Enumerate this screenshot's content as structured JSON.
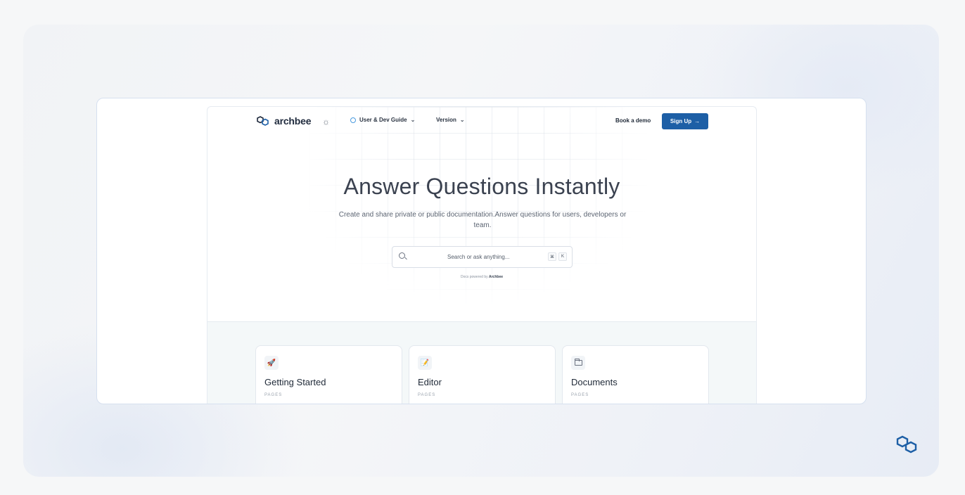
{
  "brand": {
    "name": "archbee",
    "accent": "#1d5fa6"
  },
  "nav": {
    "theme_icon": "sun-icon",
    "guide_label": "User & Dev Guide",
    "version_label": "Version",
    "book_demo": "Book a demo",
    "sign_up": "Sign Up",
    "sign_up_arrow": "→",
    "chevron": "⌄"
  },
  "hero": {
    "title": "Answer Questions Instantly",
    "subtitle": "Create and share private or public documentation.Answer questions for users, developers or team."
  },
  "search": {
    "placeholder": "Search or ask anything...",
    "shortcut_keys": [
      "⌘",
      "K"
    ],
    "powered_prefix": "Docs powered by",
    "powered_brand": "Archbee"
  },
  "cards": [
    {
      "icon": "rocket-icon",
      "glyph": "🚀",
      "title": "Getting Started",
      "subtitle": "PAGES"
    },
    {
      "icon": "memo-icon",
      "glyph": "📝",
      "title": "Editor",
      "subtitle": "PAGES"
    },
    {
      "icon": "folder-icon",
      "glyph": "",
      "title": "Documents",
      "subtitle": "PAGES"
    }
  ]
}
